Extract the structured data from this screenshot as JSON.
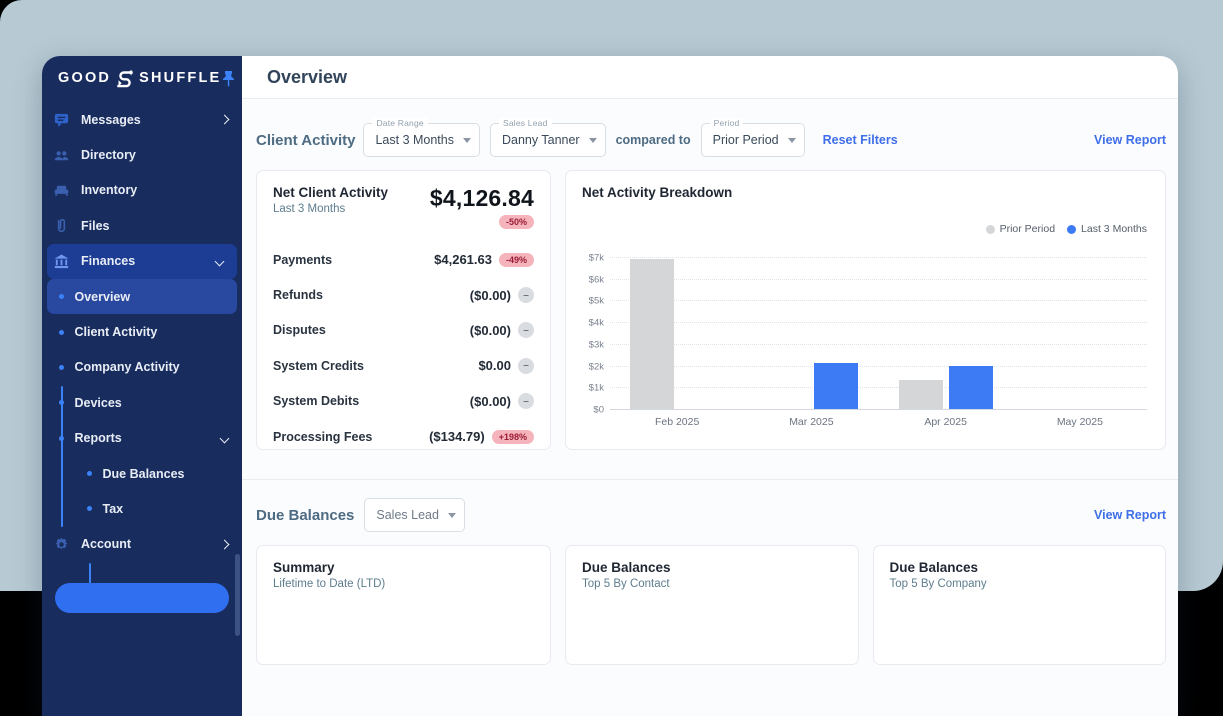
{
  "window": {
    "title": "Overview"
  },
  "sidebar": {
    "bg_color": "#182c5e",
    "accent_color": "#3b82f6",
    "logo": {
      "word1": "GOOD",
      "word2": "SHUFFLE",
      "icon": "shuffle-s-icon",
      "pin_icon": "pin-icon"
    },
    "items": [
      {
        "label": "Messages",
        "icon": "chat-icon",
        "chevron": "right",
        "level": 0
      },
      {
        "label": "Directory",
        "icon": "people-icon",
        "level": 0
      },
      {
        "label": "Inventory",
        "icon": "sofa-icon",
        "level": 0
      },
      {
        "label": "Files",
        "icon": "paperclip-icon",
        "level": 0
      },
      {
        "label": "Finances",
        "icon": "bank-icon",
        "chevron": "down",
        "level": 0,
        "active": true
      },
      {
        "label": "Overview",
        "level": 1,
        "active": true
      },
      {
        "label": "Client Activity",
        "level": 1
      },
      {
        "label": "Company Activity",
        "level": 1
      },
      {
        "label": "Devices",
        "level": 1
      },
      {
        "label": "Reports",
        "level": 1,
        "chevron": "down"
      },
      {
        "label": "Due Balances",
        "level": 2
      },
      {
        "label": "Tax",
        "level": 2
      },
      {
        "label": "Account",
        "icon": "gear-icon",
        "chevron": "right",
        "level": 0
      }
    ]
  },
  "client_activity": {
    "title": "Client Activity",
    "filters": [
      {
        "label": "Date Range",
        "value": "Last 3 Months"
      },
      {
        "label": "Sales Lead",
        "value": "Danny Tanner"
      },
      {
        "label": "Period",
        "value": "Prior Period"
      }
    ],
    "compared_to": "compared to",
    "reset_label": "Reset Filters",
    "view_report_label": "View Report",
    "summary_card": {
      "title": "Net Client Activity",
      "subtitle": "Last 3 Months",
      "total": "$4,126.84",
      "total_badge": "-50%",
      "total_badge_type": "pink",
      "rows": [
        {
          "label": "Payments",
          "value": "$4,261.63",
          "badge": "-49%",
          "badge_type": "pink"
        },
        {
          "label": "Refunds",
          "value": "($0.00)",
          "badge": "–",
          "badge_type": "gray"
        },
        {
          "label": "Disputes",
          "value": "($0.00)",
          "badge": "–",
          "badge_type": "gray"
        },
        {
          "label": "System Credits",
          "value": "$0.00",
          "badge": "–",
          "badge_type": "gray"
        },
        {
          "label": "System Debits",
          "value": "($0.00)",
          "badge": "–",
          "badge_type": "gray"
        },
        {
          "label": "Processing Fees",
          "value": "($134.79)",
          "badge": "+198%",
          "badge_type": "pink"
        }
      ]
    }
  },
  "chart_data": {
    "type": "bar",
    "title": "Net Activity Breakdown",
    "categories": [
      "Feb 2025",
      "Mar 2025",
      "Apr 2025",
      "May 2025"
    ],
    "series": [
      {
        "name": "Prior Period",
        "color": "#d5d6d8",
        "values": [
          6900,
          0,
          1350,
          0
        ]
      },
      {
        "name": "Last 3 Months",
        "color": "#3d7bf5",
        "values": [
          0,
          2100,
          2000,
          0
        ]
      }
    ],
    "xlabel": "",
    "ylabel": "",
    "ylim": [
      0,
      7000
    ],
    "ytick_labels": [
      "$7k",
      "$6k",
      "$5k",
      "$4k",
      "$3k",
      "$2k",
      "$1k",
      "$0"
    ],
    "grid": "dotted-horizontal",
    "legend_position": "top-right"
  },
  "due_balances": {
    "title": "Due Balances",
    "filter_value": "Sales Lead",
    "view_report_label": "View Report",
    "cards": [
      {
        "title": "Summary",
        "subtitle": "Lifetime to Date (LTD)"
      },
      {
        "title": "Due Balances",
        "subtitle": "Top 5 By Contact"
      },
      {
        "title": "Due Balances",
        "subtitle": "Top 5 By Company"
      }
    ]
  }
}
